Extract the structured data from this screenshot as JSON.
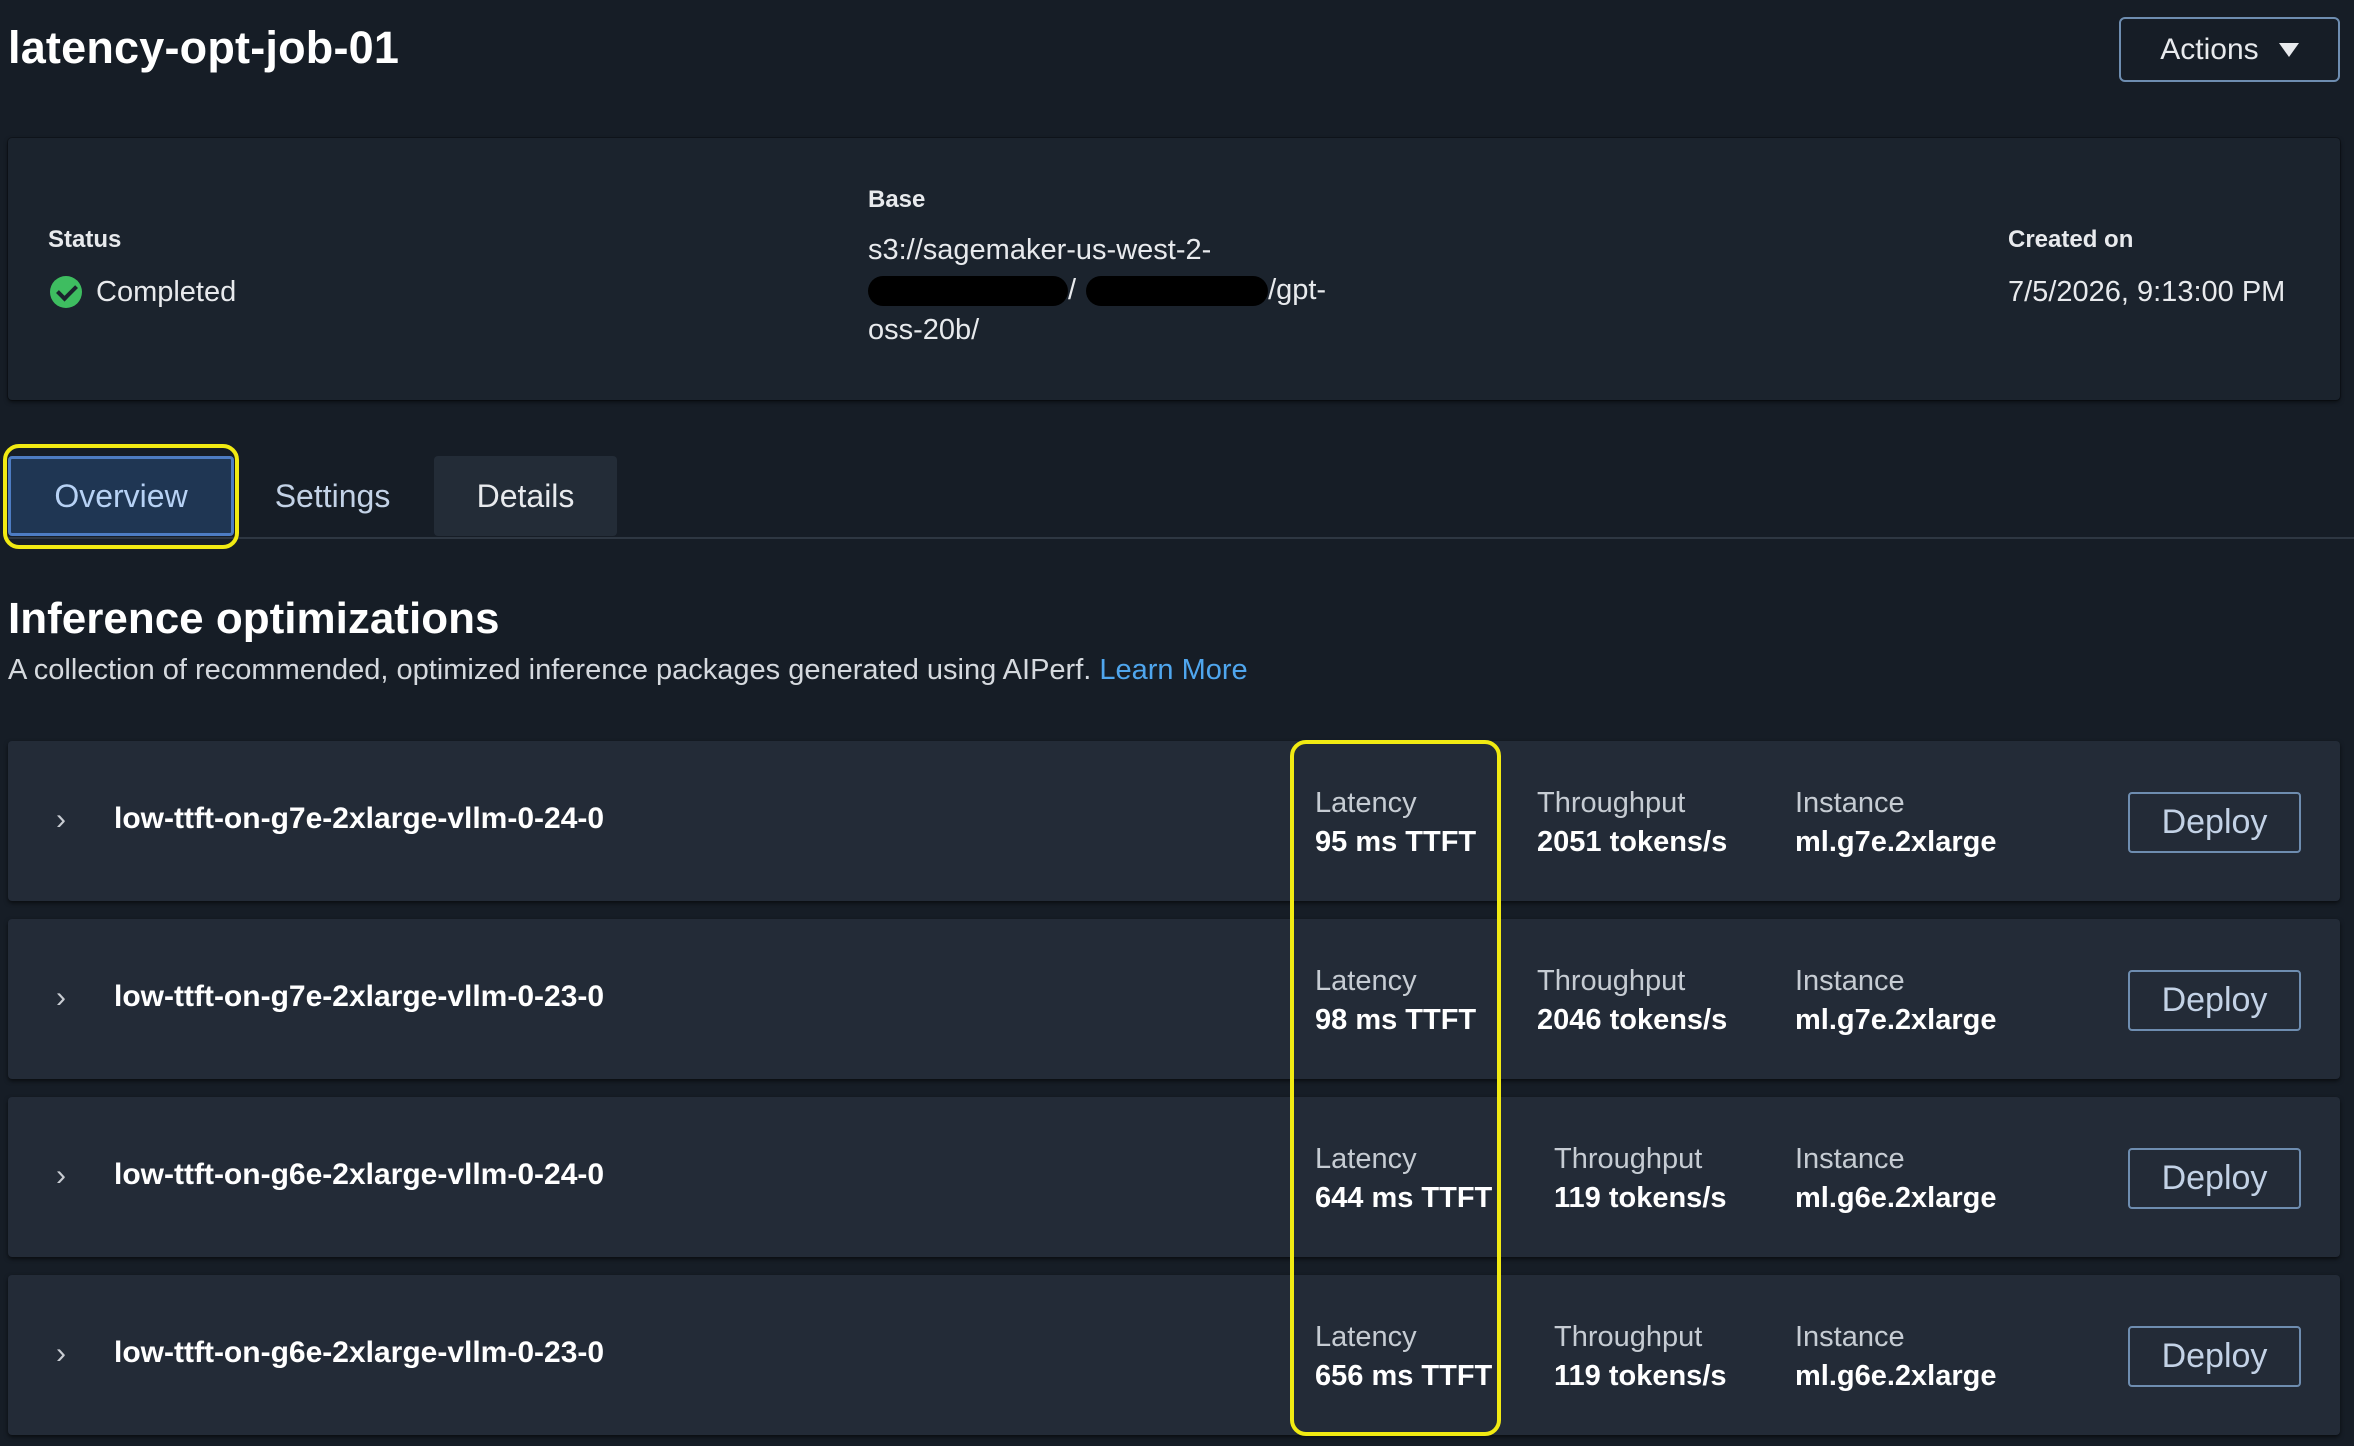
{
  "page": {
    "title": "latency-opt-job-01",
    "actions_label": "Actions"
  },
  "summary": {
    "status_label": "Status",
    "status_value": "Completed",
    "base_label": "Base",
    "base_line1": "s3://sagemaker-us-west-2-",
    "base_sep": "/",
    "base_line2_end": "/gpt-",
    "base_line3": "oss-20b/",
    "created_label": "Created on",
    "created_value": "7/5/2026, 9:13:00 PM"
  },
  "tabs": [
    {
      "label": "Overview",
      "selected": true
    },
    {
      "label": "Settings",
      "selected": false
    },
    {
      "label": "Details",
      "selected": false
    }
  ],
  "section": {
    "title": "Inference optimizations",
    "description": "A collection of recommended, optimized inference packages generated using AIPerf.",
    "learn_more": "Learn More"
  },
  "metric_labels": {
    "latency": "Latency",
    "throughput": "Throughput",
    "instance": "Instance"
  },
  "deploy_label": "Deploy",
  "rows": [
    {
      "name": "low-ttft-on-g7e-2xlarge-vllm-0-24-0",
      "latency": "95 ms TTFT",
      "throughput": "2051 tokens/s",
      "instance": "ml.g7e.2xlarge"
    },
    {
      "name": "low-ttft-on-g7e-2xlarge-vllm-0-23-0",
      "latency": "98 ms TTFT",
      "throughput": "2046 tokens/s",
      "instance": "ml.g7e.2xlarge"
    },
    {
      "name": "low-ttft-on-g6e-2xlarge-vllm-0-24-0",
      "latency": "644 ms TTFT",
      "throughput": "119 tokens/s",
      "instance": "ml.g6e.2xlarge"
    },
    {
      "name": "low-ttft-on-g6e-2xlarge-vllm-0-23-0",
      "latency": "656 ms TTFT",
      "throughput": "119 tokens/s",
      "instance": "ml.g6e.2xlarge"
    }
  ],
  "colors": {
    "background": "#161d26",
    "highlight": "#f1ea12",
    "link": "#4fa6ee",
    "status_ok": "#3ebd60"
  }
}
